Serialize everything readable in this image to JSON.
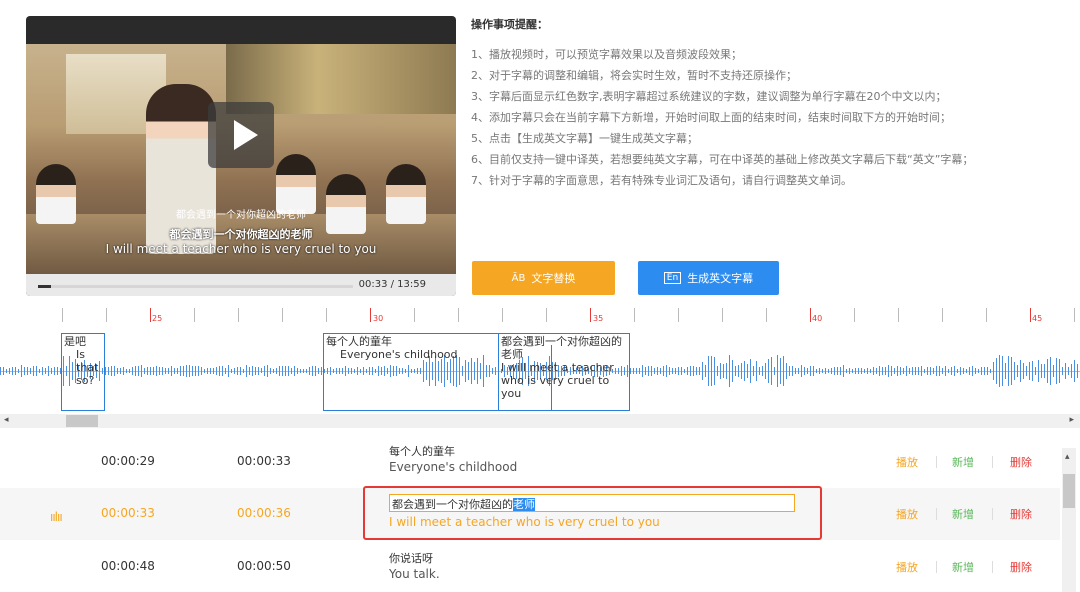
{
  "video": {
    "subtitle_small": "都会遇到一个对你超凶的老师",
    "subtitle_cn": "都会遇到一个对你超凶的老师",
    "subtitle_en": "I will meet a teacher who is very cruel to you",
    "time": "00:33 / 13:59",
    "progress_fraction": 0.04
  },
  "notes": {
    "title": "操作事项提醒：",
    "items": [
      "1、播放视频时，可以预览字幕效果以及音频波段效果；",
      "2、对于字幕的调整和编辑，将会实时生效，暂时不支持还原操作；",
      "3、字幕后面显示红色数字,表明字幕超过系统建议的字数，建议调整为单行字幕在20个中文以内；",
      "4、添加字幕只会在当前字幕下方新增，开始时间取上面的结束时间，结束时间取下方的开始时间；",
      "5、点击【生成英文字幕】一键生成英文字幕；",
      "6、目前仅支持一键中译英，若想要纯英文字幕，可在中译英的基础上修改英文字幕后下载“英文”字幕；",
      "7、针对于字幕的字面意思，若有特殊专业词汇及语句，请自行调整英文单词。"
    ]
  },
  "buttons": {
    "replace": "文字替换",
    "replace_icon": "ĀB",
    "generate": "生成英文字幕",
    "generate_icon": "En"
  },
  "ruler": {
    "labels": [
      "25",
      "30",
      "35",
      "40",
      "45"
    ]
  },
  "segments": [
    {
      "cn": "是吧",
      "en": "Is that so?"
    },
    {
      "cn": "每个人的童年",
      "en": "Everyone's childhood"
    },
    {
      "cn": "都会遇到一个对你超凶的老师",
      "en": "I will meet a teacher who is very cruel to you"
    }
  ],
  "rows": [
    {
      "start": "00:00:29",
      "end": "00:00:33",
      "cn": "每个人的童年",
      "en": "Everyone's childhood"
    },
    {
      "start": "00:00:33",
      "end": "00:00:36",
      "cn_a": "都会遇到一个对你超凶的",
      "cn_sel": "老师",
      "en": "I will meet a teacher who is very cruel to you"
    },
    {
      "start": "00:00:48",
      "end": "00:00:50",
      "cn": "你说话呀",
      "en": "You talk."
    }
  ],
  "actions": {
    "play": "播放",
    "add": "新增",
    "delete": "删除"
  },
  "colors": {
    "orange": "#f5a623",
    "blue": "#2d8cf0",
    "green": "#5cb85c",
    "red": "#e53935"
  }
}
